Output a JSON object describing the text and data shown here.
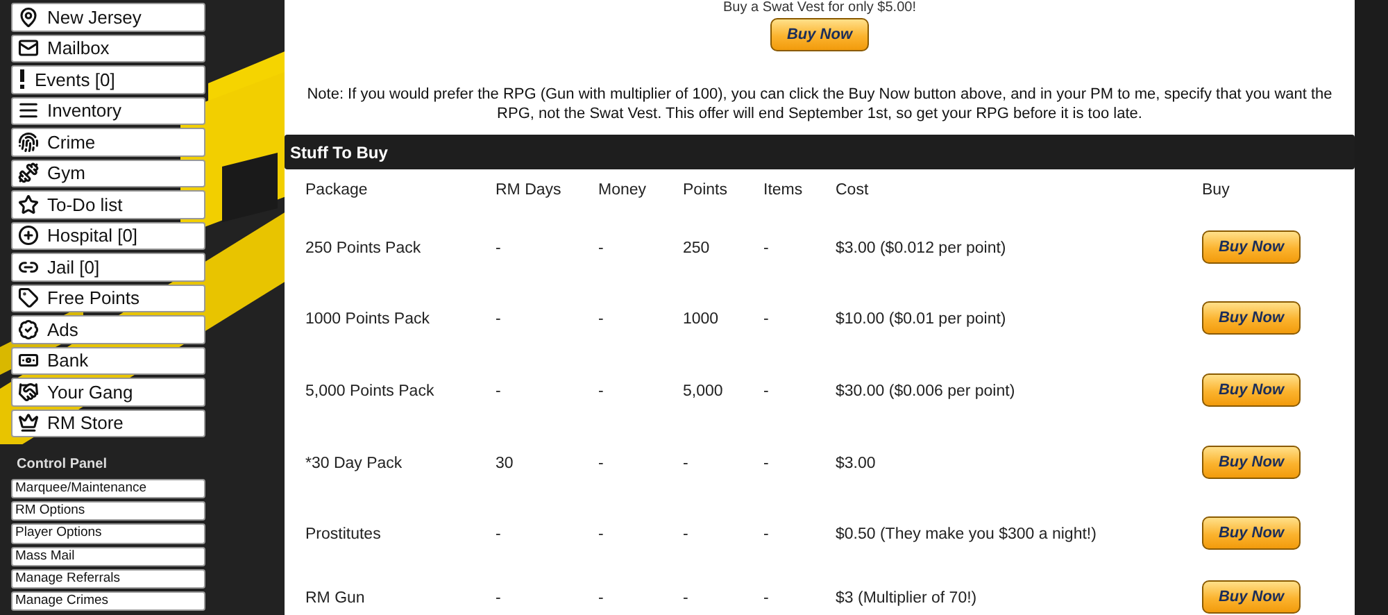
{
  "sidebar": {
    "items": [
      {
        "label": "New Jersey"
      },
      {
        "label": "Mailbox"
      },
      {
        "label": "Events [0]"
      },
      {
        "label": "Inventory"
      },
      {
        "label": "Crime"
      },
      {
        "label": "Gym"
      },
      {
        "label": "To-Do list"
      },
      {
        "label": "Hospital [0]"
      },
      {
        "label": "Jail [0]"
      },
      {
        "label": "Free Points"
      },
      {
        "label": "Ads"
      },
      {
        "label": "Bank"
      },
      {
        "label": "Your Gang"
      },
      {
        "label": "RM Store"
      }
    ]
  },
  "control_panel": {
    "title": "Control Panel",
    "items": [
      "Marquee/Maintenance",
      "RM Options",
      "Player Options",
      "Mass Mail",
      "Manage Referrals",
      "Manage Crimes"
    ]
  },
  "promo": {
    "text": "Buy a Swat Vest for only $5.00!",
    "button": "Buy Now"
  },
  "note": "Note: If you would prefer the RPG (Gun with multiplier of 100), you can click the Buy Now button above, and in your PM to me, specify that you want the RPG, not the Swat Vest. This offer will end September 1st, so get your RPG before it is too late.",
  "section": {
    "title": "Stuff To Buy"
  },
  "table": {
    "columns": [
      "Package",
      "RM Days",
      "Money",
      "Points",
      "Items",
      "Cost",
      "Buy"
    ],
    "rows": [
      {
        "cells": [
          "250 Points Pack",
          "-",
          "-",
          "250",
          "-",
          "$3.00 ($0.012 per point)"
        ],
        "button": "Buy Now"
      },
      {
        "cells": [
          "1000 Points Pack",
          "-",
          "-",
          "1000",
          "-",
          "$10.00 ($0.01 per point)"
        ],
        "button": "Buy Now"
      },
      {
        "cells": [
          "5,000 Points Pack",
          "-",
          "-",
          "5,000",
          "-",
          "$30.00 ($0.006 per point)"
        ],
        "button": "Buy Now"
      },
      {
        "cells": [
          "*30 Day Pack",
          "30",
          "-",
          "-",
          "-",
          "$3.00"
        ],
        "button": "Buy Now"
      },
      {
        "cells": [
          "Prostitutes",
          "-",
          "-",
          "-",
          "-",
          "$0.50 (They make you $300 a night!)"
        ],
        "button": "Buy Now"
      },
      {
        "cells": [
          "RM Gun",
          "-",
          "-",
          "-",
          "-",
          "$3 (Multiplier of 70!)"
        ],
        "button": "Buy Now"
      }
    ]
  }
}
